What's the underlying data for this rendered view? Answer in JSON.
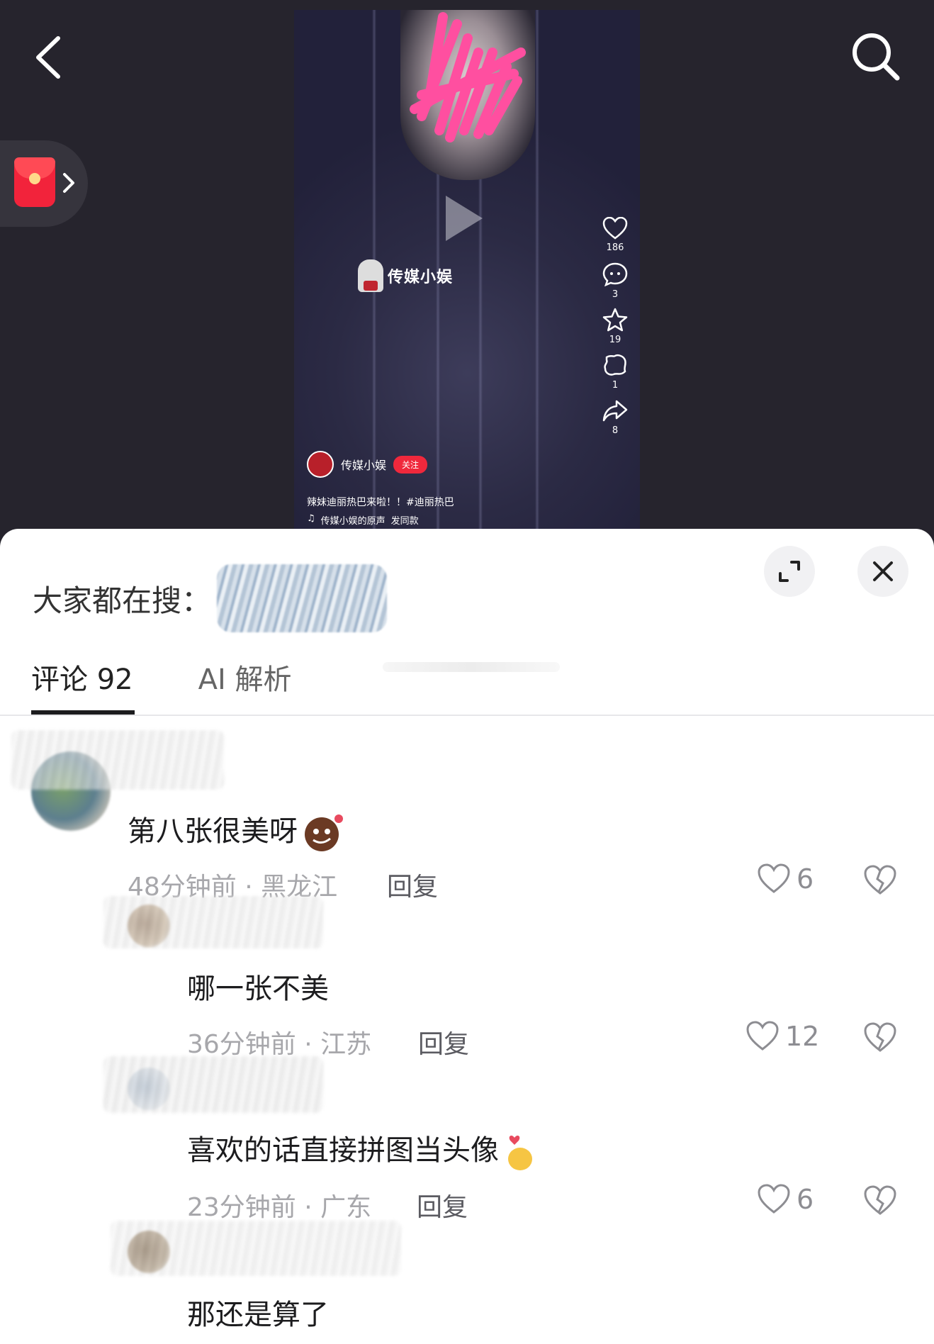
{
  "video": {
    "watermark": "传媒小娱",
    "likes": "186",
    "comments": "3",
    "favorites": "19",
    "gifts": "1",
    "shares": "8",
    "author": "传媒小娱",
    "follow_label": "关注",
    "caption": "辣妹迪丽热巴来啦！！#迪丽热巴",
    "music": "传媒小娱的原声",
    "music_action": "发同款"
  },
  "sheet": {
    "search_label": "大家都在搜：",
    "tabs": [
      {
        "label": "评论 92",
        "active": true
      },
      {
        "label": "AI 解析",
        "active": false
      }
    ]
  },
  "comments": [
    {
      "text": "第八张很美呀",
      "time_location": "48分钟前 · 黑龙江",
      "reply": "回复",
      "likes": "6"
    },
    {
      "text": "哪一张不美",
      "time_location": "36分钟前 · 江苏",
      "reply": "回复",
      "likes": "12"
    },
    {
      "text": "喜欢的话直接拼图当头像",
      "time_location": "23分钟前 · 广东",
      "reply": "回复",
      "likes": "6"
    },
    {
      "text": "那还是算了"
    }
  ],
  "colors": {
    "background_dark": "#26242d",
    "sheet": "#ffffff",
    "accent_red": "#f0283c"
  },
  "icons": [
    "back-icon",
    "search-icon",
    "red-packet-icon",
    "heart-icon",
    "comment-icon",
    "star-icon",
    "gift-icon",
    "share-icon",
    "expand-icon",
    "close-icon",
    "dislike-icon",
    "music-icon",
    "play-icon"
  ]
}
